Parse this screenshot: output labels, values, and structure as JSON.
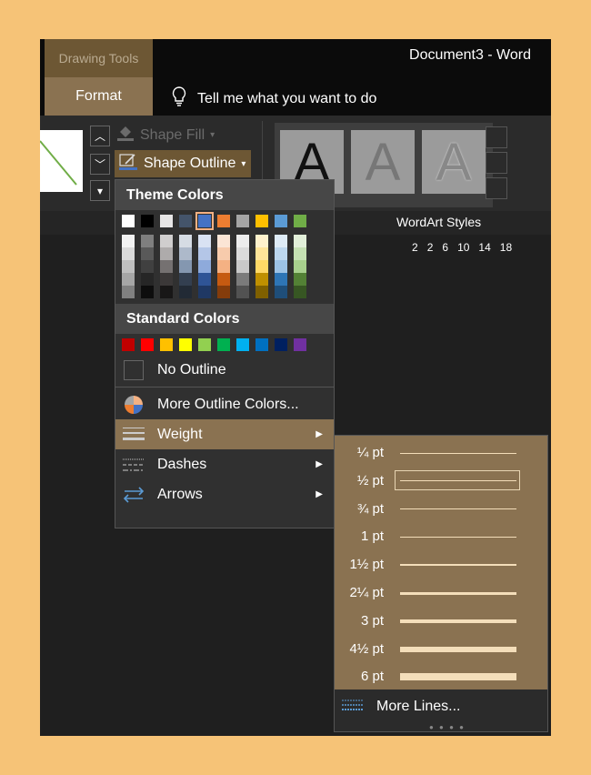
{
  "window": {
    "context_tab_group": "Drawing Tools",
    "active_tab": "Format",
    "document_title": "Document3  -  Word",
    "tell_me": "Tell me what you want to do"
  },
  "ribbon": {
    "shape_fill_label": "Shape Fill",
    "shape_outline_label": "Shape Outline",
    "wordart_group_label": "WordArt Styles",
    "wordart_letter": "A",
    "ruler_numbers": [
      "2",
      "2",
      "6",
      "10",
      "14",
      "18"
    ]
  },
  "outline_menu": {
    "theme_colors_header": "Theme Colors",
    "theme_top_row": [
      "#ffffff",
      "#000000",
      "#e7e6e6",
      "#44546a",
      "#4472c4",
      "#ed7d31",
      "#a5a5a5",
      "#ffc000",
      "#5b9bd5",
      "#70ad47"
    ],
    "theme_shades": [
      [
        "#f2f2f2",
        "#d9d9d9",
        "#bfbfbf",
        "#a6a6a6",
        "#808080"
      ],
      [
        "#7f7f7f",
        "#595959",
        "#404040",
        "#262626",
        "#0d0d0d"
      ],
      [
        "#d0cece",
        "#aeabab",
        "#757171",
        "#3b3838",
        "#181717"
      ],
      [
        "#d6dce4",
        "#adb9ca",
        "#8497b0",
        "#333f50",
        "#222a35"
      ],
      [
        "#d9e2f3",
        "#b4c6e7",
        "#8eaadb",
        "#2f5496",
        "#1f3864"
      ],
      [
        "#fbe5d5",
        "#f7cbac",
        "#f4b183",
        "#c55a11",
        "#843c0b"
      ],
      [
        "#ededed",
        "#dbdbdb",
        "#c9c9c9",
        "#7b7b7b",
        "#525252"
      ],
      [
        "#fff2cc",
        "#ffe599",
        "#ffd966",
        "#bf9000",
        "#7f6000"
      ],
      [
        "#deebf6",
        "#bdd7ee",
        "#9dc3e6",
        "#2e75b5",
        "#1f4e79"
      ],
      [
        "#e2efd9",
        "#c5e0b3",
        "#a8d08d",
        "#538135",
        "#375623"
      ]
    ],
    "standard_colors_header": "Standard Colors",
    "standard_colors": [
      "#c00000",
      "#ff0000",
      "#ffc000",
      "#ffff00",
      "#92d050",
      "#00b050",
      "#00b0f0",
      "#0070c0",
      "#002060",
      "#7030a0"
    ],
    "no_outline": "No Outline",
    "more_outline_colors": "More Outline Colors...",
    "weight": "Weight",
    "dashes": "Dashes",
    "arrows": "Arrows"
  },
  "weight_submenu": {
    "items": [
      {
        "label": "¼ pt",
        "thickness_pt": 0.25
      },
      {
        "label": "½ pt",
        "thickness_pt": 0.5
      },
      {
        "label": "¾ pt",
        "thickness_pt": 0.75
      },
      {
        "label": "1 pt",
        "thickness_pt": 1
      },
      {
        "label": "1½ pt",
        "thickness_pt": 1.5
      },
      {
        "label": "2¼ pt",
        "thickness_pt": 2.25
      },
      {
        "label": "3 pt",
        "thickness_pt": 3
      },
      {
        "label": "4½ pt",
        "thickness_pt": 4.5
      },
      {
        "label": "6 pt",
        "thickness_pt": 6
      }
    ],
    "selected": "½ pt",
    "more_lines": "More Lines..."
  },
  "colors": {
    "accent_dark": "#6d5734",
    "accent": "#8a7251",
    "outer_background": "#f6c377"
  }
}
